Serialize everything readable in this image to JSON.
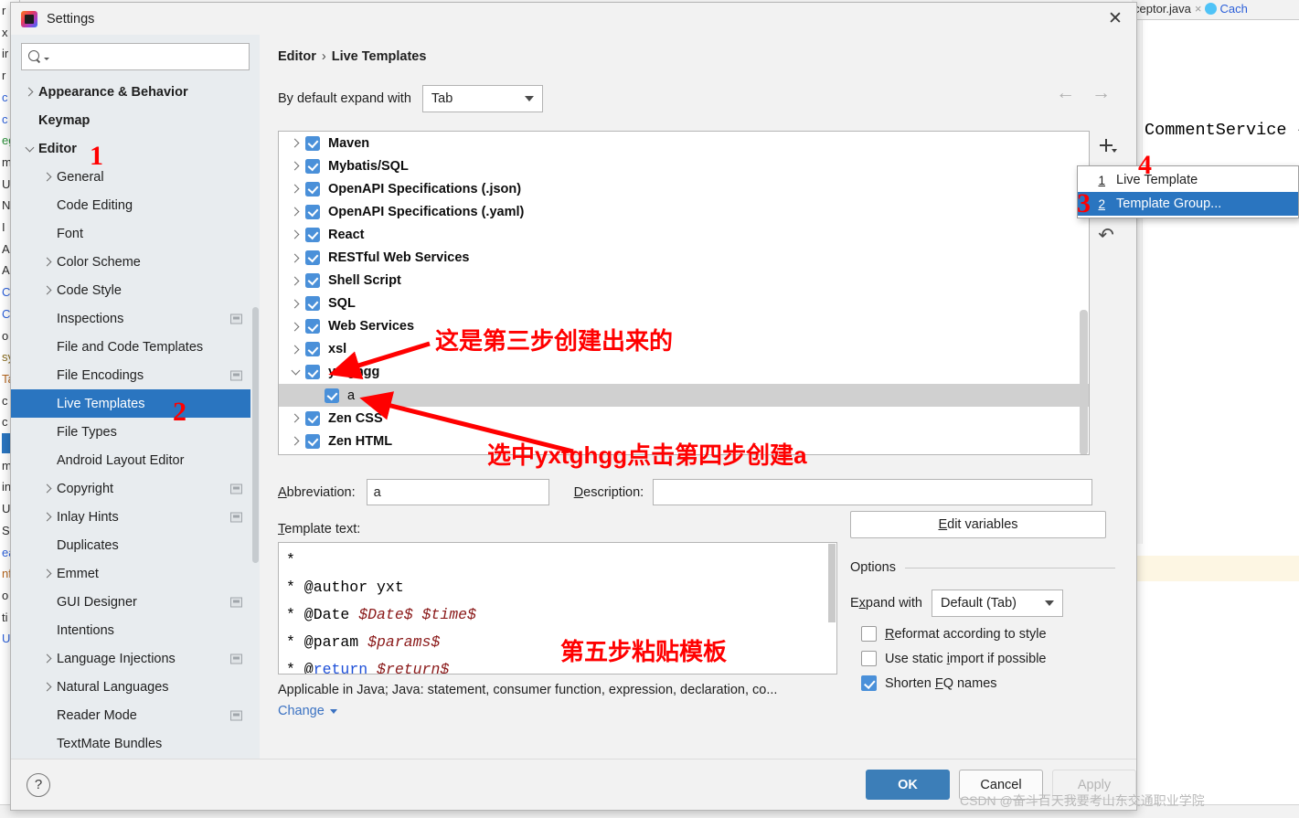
{
  "background_ide": {
    "tab_partial": "ceptor.java",
    "tab_close_glyph": "×",
    "tab2_partial": "Cach",
    "code_fragment": "CommentService {",
    "left_gutter_chars": [
      "r",
      "x",
      "ir",
      "r",
      "c",
      "c",
      "eg",
      "m",
      "U",
      "N",
      "",
      "I",
      "Al",
      "Al",
      "Ca",
      "Co",
      "o",
      "sy",
      "Ta",
      "c",
      "c",
      "eg",
      "m",
      "in",
      "U",
      "S",
      "ea",
      "",
      "nf",
      "o",
      "ti",
      "U"
    ]
  },
  "window": {
    "title": "Settings",
    "app_icon": "intellij-idea-icon",
    "close_icon": "close-icon",
    "close_glyph": "✕"
  },
  "search": {
    "placeholder": "",
    "value": "",
    "icon": "search-icon"
  },
  "sidebar": {
    "items": [
      {
        "label": "Appearance & Behavior",
        "indent": 0,
        "arrow": "right",
        "bold": true,
        "badge": false,
        "selected": false
      },
      {
        "label": "Keymap",
        "indent": 0,
        "arrow": "none",
        "bold": true,
        "badge": false,
        "selected": false
      },
      {
        "label": "Editor",
        "indent": 0,
        "arrow": "down",
        "bold": true,
        "badge": false,
        "selected": false
      },
      {
        "label": "General",
        "indent": 1,
        "arrow": "right",
        "bold": false,
        "badge": false,
        "selected": false
      },
      {
        "label": "Code Editing",
        "indent": 1,
        "arrow": "none",
        "bold": false,
        "badge": false,
        "selected": false
      },
      {
        "label": "Font",
        "indent": 1,
        "arrow": "none",
        "bold": false,
        "badge": false,
        "selected": false
      },
      {
        "label": "Color Scheme",
        "indent": 1,
        "arrow": "right",
        "bold": false,
        "badge": false,
        "selected": false
      },
      {
        "label": "Code Style",
        "indent": 1,
        "arrow": "right",
        "bold": false,
        "badge": false,
        "selected": false
      },
      {
        "label": "Inspections",
        "indent": 1,
        "arrow": "none",
        "bold": false,
        "badge": true,
        "selected": false
      },
      {
        "label": "File and Code Templates",
        "indent": 1,
        "arrow": "none",
        "bold": false,
        "badge": false,
        "selected": false
      },
      {
        "label": "File Encodings",
        "indent": 1,
        "arrow": "none",
        "bold": false,
        "badge": true,
        "selected": false
      },
      {
        "label": "Live Templates",
        "indent": 1,
        "arrow": "none",
        "bold": false,
        "badge": false,
        "selected": true
      },
      {
        "label": "File Types",
        "indent": 1,
        "arrow": "none",
        "bold": false,
        "badge": false,
        "selected": false
      },
      {
        "label": "Android Layout Editor",
        "indent": 1,
        "arrow": "none",
        "bold": false,
        "badge": false,
        "selected": false
      },
      {
        "label": "Copyright",
        "indent": 1,
        "arrow": "right",
        "bold": false,
        "badge": true,
        "selected": false
      },
      {
        "label": "Inlay Hints",
        "indent": 1,
        "arrow": "right",
        "bold": false,
        "badge": true,
        "selected": false
      },
      {
        "label": "Duplicates",
        "indent": 1,
        "arrow": "none",
        "bold": false,
        "badge": false,
        "selected": false
      },
      {
        "label": "Emmet",
        "indent": 1,
        "arrow": "right",
        "bold": false,
        "badge": false,
        "selected": false
      },
      {
        "label": "GUI Designer",
        "indent": 1,
        "arrow": "none",
        "bold": false,
        "badge": true,
        "selected": false
      },
      {
        "label": "Intentions",
        "indent": 1,
        "arrow": "none",
        "bold": false,
        "badge": false,
        "selected": false
      },
      {
        "label": "Language Injections",
        "indent": 1,
        "arrow": "right",
        "bold": false,
        "badge": true,
        "selected": false
      },
      {
        "label": "Natural Languages",
        "indent": 1,
        "arrow": "right",
        "bold": false,
        "badge": false,
        "selected": false
      },
      {
        "label": "Reader Mode",
        "indent": 1,
        "arrow": "none",
        "bold": false,
        "badge": true,
        "selected": false
      },
      {
        "label": "TextMate Bundles",
        "indent": 1,
        "arrow": "none",
        "bold": false,
        "badge": false,
        "selected": false
      }
    ]
  },
  "breadcrumb": {
    "root": "Editor",
    "separator": "›",
    "leaf": "Live Templates"
  },
  "nav": {
    "back_glyph": "←",
    "forward_glyph": "→"
  },
  "expand_with": {
    "label": "By default expand with",
    "value": "Tab"
  },
  "template_list": {
    "rows": [
      {
        "label": "Maven",
        "arrow": "right",
        "level": 0,
        "checked": true,
        "selected": false
      },
      {
        "label": "Mybatis/SQL",
        "arrow": "right",
        "level": 0,
        "checked": true,
        "selected": false
      },
      {
        "label": "OpenAPI Specifications (.json)",
        "arrow": "right",
        "level": 0,
        "checked": true,
        "selected": false
      },
      {
        "label": "OpenAPI Specifications (.yaml)",
        "arrow": "right",
        "level": 0,
        "checked": true,
        "selected": false
      },
      {
        "label": "React",
        "arrow": "right",
        "level": 0,
        "checked": true,
        "selected": false
      },
      {
        "label": "RESTful Web Services",
        "arrow": "right",
        "level": 0,
        "checked": true,
        "selected": false
      },
      {
        "label": "Shell Script",
        "arrow": "right",
        "level": 0,
        "checked": true,
        "selected": false
      },
      {
        "label": "SQL",
        "arrow": "right",
        "level": 0,
        "checked": true,
        "selected": false
      },
      {
        "label": "Web Services",
        "arrow": "right",
        "level": 0,
        "checked": true,
        "selected": false
      },
      {
        "label": "xsl",
        "arrow": "right",
        "level": 0,
        "checked": true,
        "selected": false
      },
      {
        "label": "yxtghgg",
        "arrow": "down",
        "level": 0,
        "checked": true,
        "selected": false
      },
      {
        "label": "a",
        "arrow": "none",
        "level": 1,
        "checked": true,
        "selected": true
      },
      {
        "label": "Zen CSS",
        "arrow": "right",
        "level": 0,
        "checked": true,
        "selected": false
      },
      {
        "label": "Zen HTML",
        "arrow": "right",
        "level": 0,
        "checked": true,
        "selected": false
      }
    ],
    "toolbar": {
      "add_icon": "plus-icon",
      "revert_icon": "undo-arrow-icon"
    }
  },
  "add_menu": {
    "items": [
      {
        "number": "1",
        "label": "Live Template",
        "selected": false
      },
      {
        "number": "2",
        "label": "Template Group...",
        "selected": true
      }
    ]
  },
  "abbreviation": {
    "label": "Abbreviation:",
    "value": "a"
  },
  "description": {
    "label": "Description:",
    "value": ""
  },
  "template_text": {
    "label": "Template text:",
    "lines": [
      [
        {
          "t": "*",
          "s": "plain"
        }
      ],
      [
        {
          "t": " * @author yxt",
          "s": "plain"
        }
      ],
      [
        {
          "t": " * @Date ",
          "s": "plain"
        },
        {
          "t": "$Date$ $time$",
          "s": "var"
        }
      ],
      [
        {
          "t": " * @param ",
          "s": "plain"
        },
        {
          "t": "$params$",
          "s": "var"
        }
      ],
      [
        {
          "t": " * @",
          "s": "plain"
        },
        {
          "t": "return",
          "s": "kw"
        },
        {
          "t": " ",
          "s": "plain"
        },
        {
          "t": "$return$",
          "s": "var"
        }
      ]
    ]
  },
  "applicable": {
    "text": "Applicable in Java; Java: statement, consumer function, expression, declaration, co...",
    "change_label": "Change"
  },
  "options": {
    "edit_variables_label": "Edit variables",
    "legend": "Options",
    "expand_with_label": "Expand with",
    "expand_with_value": "Default (Tab)",
    "checkboxes": [
      {
        "label": "Reformat according to style",
        "checked": false
      },
      {
        "label": "Use static import if possible",
        "checked": false
      },
      {
        "label": "Shorten FQ names",
        "checked": true
      }
    ]
  },
  "footer": {
    "help_glyph": "?",
    "ok": "OK",
    "cancel": "Cancel",
    "apply": "Apply"
  },
  "annotations": {
    "n1": "1",
    "n2": "2",
    "n3": "3",
    "n4": "4",
    "note_group_created": "这是第三步创建出来的",
    "note_select_create": "选中yxtghgg点击第四步创建a",
    "note_paste": "第五步粘贴模板"
  },
  "watermark": {
    "text": "CSDN @奋斗百天我要考山东交通职业学院"
  },
  "colors": {
    "accent_blue": "#2a75c0",
    "checkbox_blue": "#4a90d9",
    "annotation_red": "#ff0000",
    "ok_button": "#3c7eb8",
    "dialog_bg": "#f2f2f2",
    "sidebar_bg": "#e8ecef",
    "selected_row_gray": "#d0d0d0"
  }
}
